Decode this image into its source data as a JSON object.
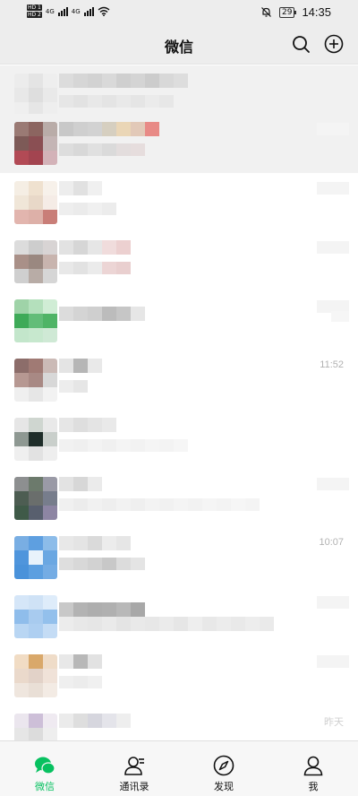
{
  "status_bar": {
    "hd_top": "HD 1",
    "hd_bottom": "HD 2",
    "signal_1": "4G",
    "signal_2": "4G",
    "battery": "29",
    "time": "14:35",
    "icons": [
      "hd-icon",
      "signal-icon",
      "wifi-icon",
      "mute-bell-icon",
      "battery-icon"
    ]
  },
  "nav": {
    "title": "微信",
    "search_icon": "search-icon",
    "add_icon": "plus-circle-icon"
  },
  "chats": [
    {
      "time": "",
      "pinned": true
    },
    {
      "time": "",
      "pinned": true
    },
    {
      "time": ""
    },
    {
      "time": ""
    },
    {
      "time": ""
    },
    {
      "time": "11:52"
    },
    {
      "time": ""
    },
    {
      "time": ""
    },
    {
      "time": "10:07"
    },
    {
      "time": ""
    },
    {
      "time": ""
    },
    {
      "time": "昨天"
    }
  ],
  "tabs": [
    {
      "label": "微信",
      "icon": "chat-bubbles-icon",
      "active": true
    },
    {
      "label": "通讯录",
      "icon": "contacts-icon",
      "active": false
    },
    {
      "label": "发现",
      "icon": "compass-icon",
      "active": false
    },
    {
      "label": "我",
      "icon": "person-icon",
      "active": false
    }
  ],
  "colors": {
    "accent": "#07c160",
    "nav_bg": "#ededed",
    "tab_bg": "#f7f7f7",
    "time_text": "#b2b2b2"
  }
}
